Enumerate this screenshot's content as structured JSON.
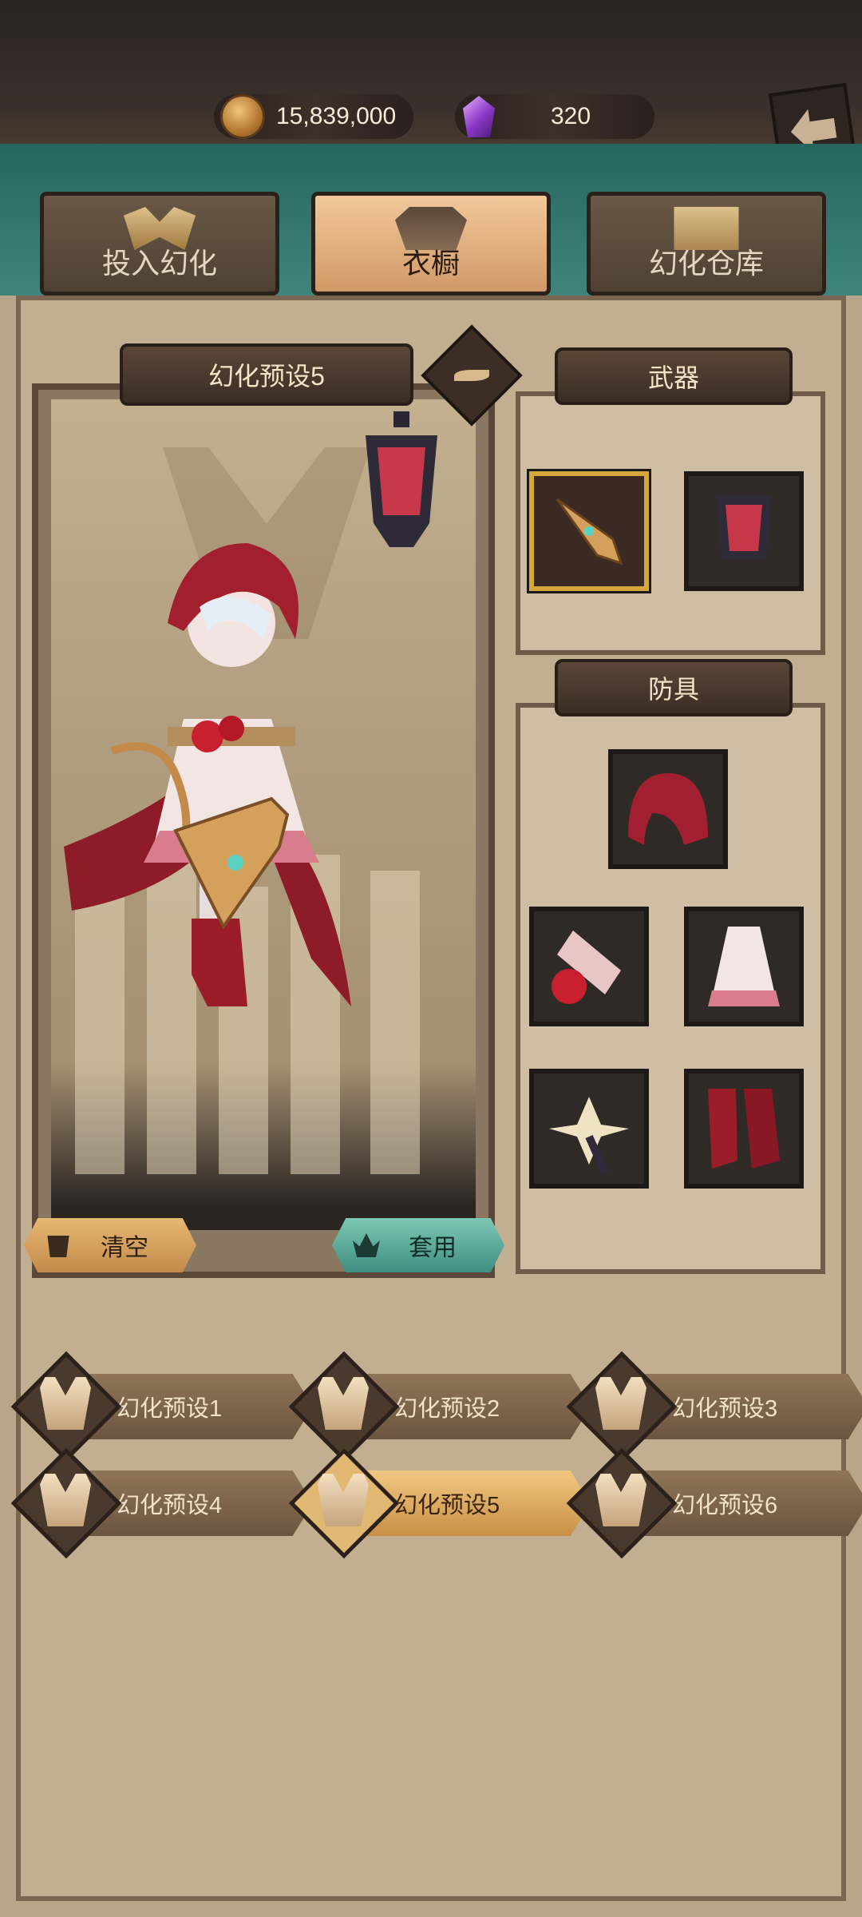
{
  "currency": {
    "coins": "15,839,000",
    "gems": "320",
    "coin_icon": "coin-icon",
    "gem_icon": "purple-gem-icon"
  },
  "tabs": [
    {
      "label": "投入幻化",
      "icon": "mask-icon",
      "active": false
    },
    {
      "label": "衣橱",
      "icon": "armor-icon",
      "active": true
    },
    {
      "label": "幻化仓库",
      "icon": "cabinet-icon",
      "active": false
    }
  ],
  "current_preset": "幻化预设5",
  "buttons": {
    "clear": "清空",
    "apply": "套用"
  },
  "weapons": {
    "title": "武器",
    "items": [
      {
        "name": "golden-sword-icon",
        "selected": true
      },
      {
        "name": "lantern-icon",
        "selected": false
      }
    ]
  },
  "armor": {
    "title": "防具",
    "items": [
      "red-hood-icon",
      "rose-gauntlet-icon",
      "white-dress-icon",
      "flower-ribbon-icon",
      "red-boots-icon"
    ]
  },
  "presets": [
    {
      "label": "幻化预设1",
      "active": false
    },
    {
      "label": "幻化预设2",
      "active": false
    },
    {
      "label": "幻化预设3",
      "active": false
    },
    {
      "label": "幻化预设4",
      "active": false
    },
    {
      "label": "幻化预设5",
      "active": true
    },
    {
      "label": "幻化预设6",
      "active": false
    }
  ],
  "colors": {
    "accent_gold": "#d29968",
    "apply_teal": "#3f8f80",
    "panel_bg": "#c2ae91",
    "hood_red": "#a11f2e"
  }
}
